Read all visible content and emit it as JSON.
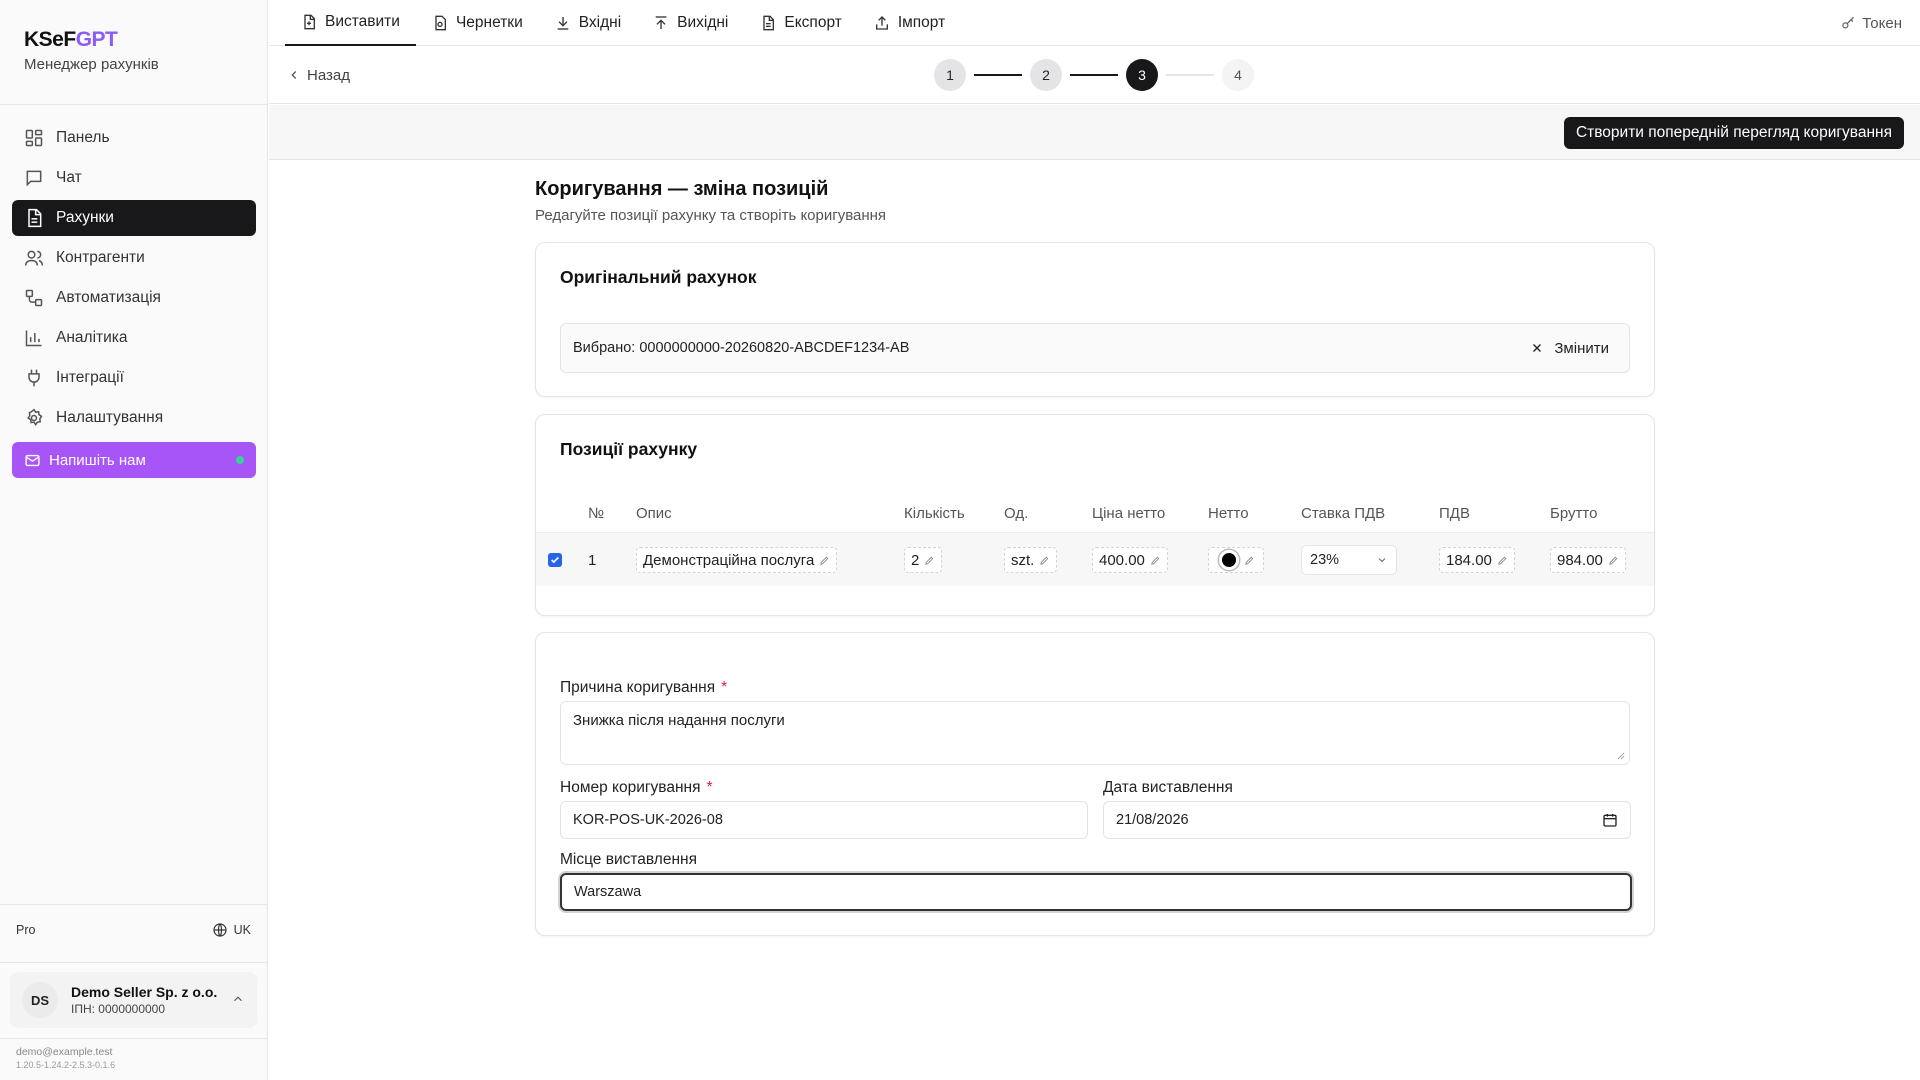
{
  "brand": {
    "name_prefix": "KSeF",
    "name_suffix": "GPT",
    "subtitle": "Менеджер рахунків"
  },
  "sidebar": {
    "items": [
      {
        "label": "Панель",
        "icon": "dashboard-icon"
      },
      {
        "label": "Чат",
        "icon": "chat-icon"
      },
      {
        "label": "Рахунки",
        "icon": "document-icon",
        "active": true
      },
      {
        "label": "Контрагенти",
        "icon": "users-icon"
      },
      {
        "label": "Автоматизація",
        "icon": "workflow-icon"
      },
      {
        "label": "Аналітика",
        "icon": "bar-chart-icon"
      },
      {
        "label": "Інтеграції",
        "icon": "plug-icon"
      },
      {
        "label": "Налаштування",
        "icon": "gear-icon"
      }
    ],
    "contact_label": "Напишіть нам",
    "plan": "Pro",
    "language": "UK",
    "account": {
      "initials": "DS",
      "name": "Demo Seller Sp. z o.o.",
      "nip": "ІПН: 0000000000"
    },
    "email": "demo@example.test",
    "version": "1.20.5-1.24.2-2.5.3-0.1.6"
  },
  "topbar": {
    "tabs": [
      {
        "label": "Виставити",
        "icon": "file-plus-icon",
        "active": true
      },
      {
        "label": "Чернетки",
        "icon": "draft-icon"
      },
      {
        "label": "Вхідні",
        "icon": "download-icon"
      },
      {
        "label": "Вихідні",
        "icon": "upload-icon"
      },
      {
        "label": "Експорт",
        "icon": "file-export-icon"
      },
      {
        "label": "Імпорт",
        "icon": "import-icon"
      }
    ],
    "token_label": "Токен"
  },
  "stepper": {
    "back_label": "Назад",
    "steps": [
      "1",
      "2",
      "3",
      "4"
    ],
    "current": 3
  },
  "actions": {
    "preview_label": "Створити попередній перегляд коригування"
  },
  "page": {
    "title": "Коригування — зміна позицій",
    "subtitle": "Редагуйте позиції рахунку та створіть коригування"
  },
  "original": {
    "title": "Оригінальний рахунок",
    "selected_text": "Вибрано: 0000000000-20260820-ABCDEF1234-AB",
    "change_label": "Змінити"
  },
  "items": {
    "title": "Позиції рахунку",
    "headers": [
      "№",
      "Опис",
      "Кількість",
      "Од.",
      "Ціна нетто",
      "Нетто",
      "Ставка ПДВ",
      "ПДВ",
      "Брутто"
    ],
    "rows": [
      {
        "checked": true,
        "num": "1",
        "description": "Демонстраційна послуга",
        "quantity": "2",
        "unit": "szt.",
        "unit_price": "400.00",
        "vat_rate": "23%",
        "vat": "184.00",
        "gross": "984.00"
      }
    ]
  },
  "form": {
    "reason_label": "Причина коригування",
    "reason_value": "Знижка після надання послуги",
    "number_label": "Номер коригування",
    "number_value": "KOR-POS-UK-2026-08",
    "date_label": "Дата виставлення",
    "date_value": "21/08/2026",
    "place_label": "Місце виставлення",
    "place_value": "Warszawa",
    "required_mark": "*"
  },
  "colors": {
    "accent": "#a855f7",
    "dark": "#18181b",
    "required": "#e11d48",
    "status_dot": "#34d399"
  }
}
